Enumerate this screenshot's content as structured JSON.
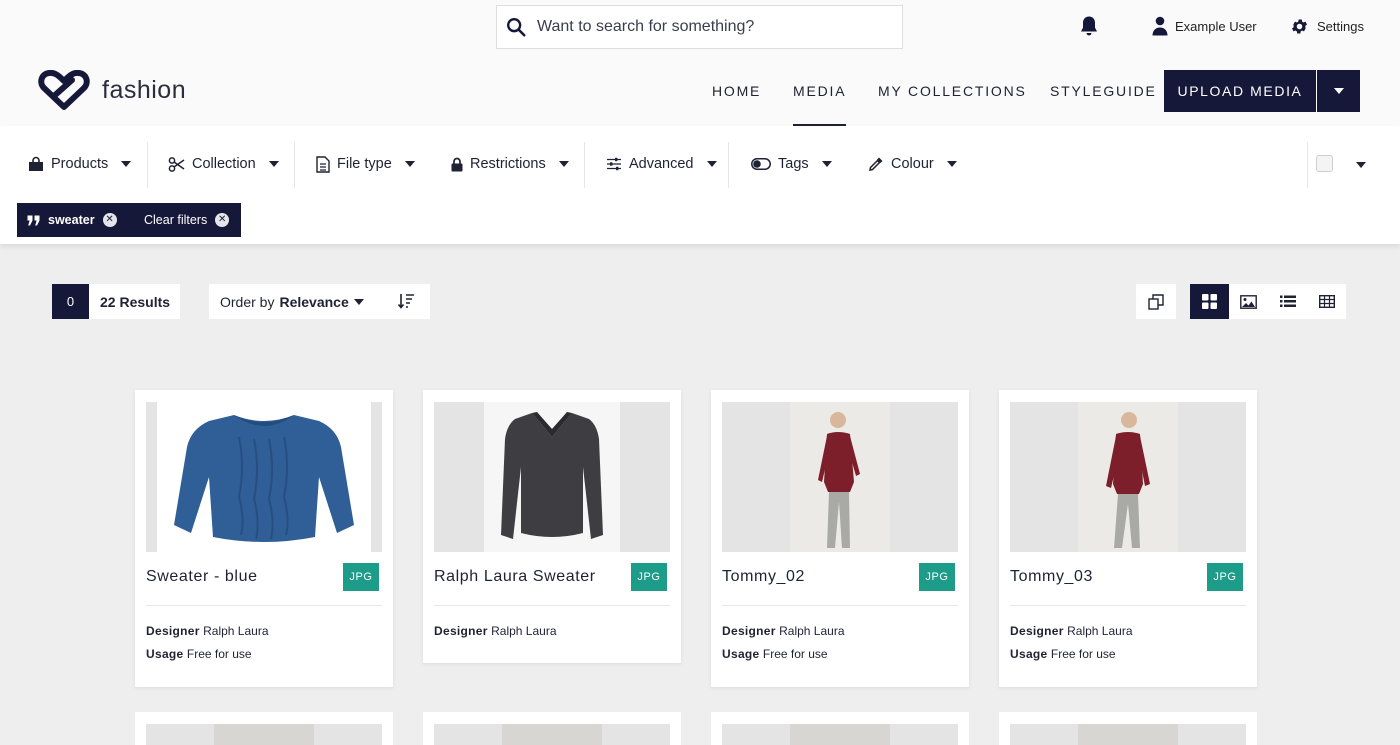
{
  "search": {
    "placeholder": "Want to search for something?"
  },
  "utility": {
    "user_label": "Example User",
    "settings_label": "Settings"
  },
  "brand": {
    "name": "fashion",
    "color": "#16183a"
  },
  "nav": {
    "items": [
      {
        "label": "HOME",
        "active": false
      },
      {
        "label": "MEDIA",
        "active": true
      },
      {
        "label": "MY COLLECTIONS",
        "active": false
      },
      {
        "label": "STYLEGUIDE",
        "active": false
      }
    ],
    "upload_label": "UPLOAD MEDIA"
  },
  "filters": [
    {
      "label": "Products",
      "icon": "shopping-bag-icon"
    },
    {
      "label": "Collection",
      "icon": "scissors-icon"
    },
    {
      "label": "File type",
      "icon": "file-icon"
    },
    {
      "label": "Restrictions",
      "icon": "lock-icon"
    },
    {
      "label": "Advanced",
      "icon": "sliders-icon"
    },
    {
      "label": "Tags",
      "icon": "toggle-icon"
    },
    {
      "label": "Colour",
      "icon": "eyedropper-icon"
    }
  ],
  "active_filters": {
    "search_term": "sweater",
    "clear_label": "Clear filters"
  },
  "results": {
    "selected_count": "0",
    "results_label": "22 Results",
    "order_prefix": "Order by",
    "order_value": "Relevance"
  },
  "cards": [
    {
      "title": "Sweater - blue",
      "badge": "JPG",
      "designer_label": "Designer",
      "designer": "Ralph Laura",
      "usage_label": "Usage",
      "usage": "Free for use"
    },
    {
      "title": "Ralph Laura Sweater",
      "badge": "JPG",
      "designer_label": "Designer",
      "designer": "Ralph Laura"
    },
    {
      "title": "Tommy_02",
      "badge": "JPG",
      "designer_label": "Designer",
      "designer": "Ralph Laura",
      "usage_label": "Usage",
      "usage": "Free for use"
    },
    {
      "title": "Tommy_03",
      "badge": "JPG",
      "designer_label": "Designer",
      "designer": "Ralph Laura",
      "usage_label": "Usage",
      "usage": "Free for use"
    }
  ],
  "colors": {
    "accent": "#16183a",
    "badge": "#1e9c8a"
  }
}
